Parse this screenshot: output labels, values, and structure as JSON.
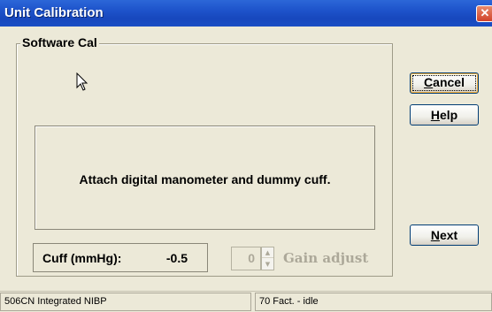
{
  "window": {
    "title": "Unit Calibration",
    "close_icon": "close-icon",
    "title_gradient": "#1f55cc"
  },
  "group": {
    "legend": "Software Cal"
  },
  "message": {
    "text": "Attach digital manometer and dummy cuff."
  },
  "cuff": {
    "label": "Cuff (mmHg):",
    "value": "-0.5"
  },
  "gain": {
    "value": "0",
    "label": "Gain adjust",
    "disabled_color": "#aca899"
  },
  "buttons": {
    "cancel_accel": "C",
    "cancel_rest": "ancel",
    "help_accel": "H",
    "help_rest": "elp",
    "next_accel": "N",
    "next_rest": "ext"
  },
  "status": {
    "left": "506CN Integrated NIBP",
    "right": "70 Fact. - idle"
  },
  "icons": {
    "cursor": "mouse-pointer-icon",
    "spin_up": "spin-up-icon",
    "spin_down": "spin-down-icon"
  }
}
